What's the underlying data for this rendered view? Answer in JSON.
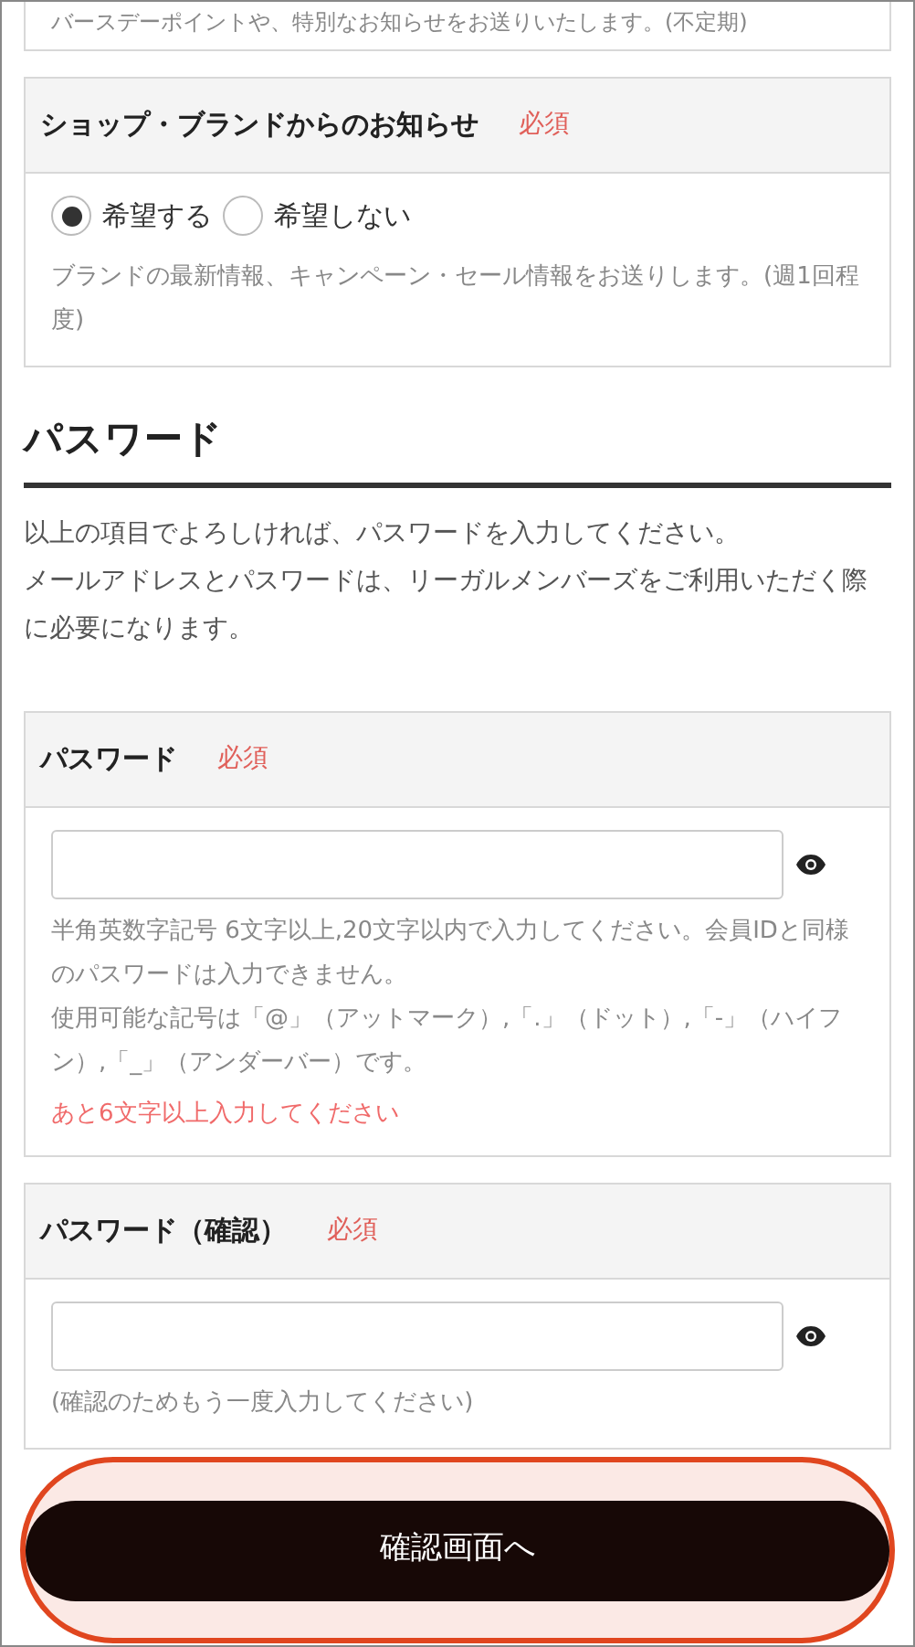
{
  "top_note": "バースデーポイントや、特別なお知らせをお送りいたします。(不定期)",
  "shop_notice": {
    "label": "ショップ・ブランドからのお知らせ",
    "required": "必須",
    "options": [
      {
        "label": "希望する",
        "selected": true
      },
      {
        "label": "希望しない",
        "selected": false
      }
    ],
    "note": "ブランドの最新情報、キャンペーン・セール情報をお送りします。(週1回程度)"
  },
  "password_section": {
    "heading": "パスワード",
    "intro": [
      "以上の項目でよろしければ、パスワードを入力してください。",
      "メールアドレスとパスワードは、リーガルメンバーズをご利用いただく際に必要になります。"
    ]
  },
  "fields": [
    {
      "label": "パスワード",
      "required": "必須",
      "hints": [
        "半角英数字記号 6文字以上,20文字以内で入力してください。会員IDと同様のパスワードは入力できません。",
        "使用可能な記号は「@」（アットマーク）,「.」（ドット）,「-」（ハイフン）,「_」（アンダーバー）です。"
      ],
      "error": "あと6文字以上入力してください"
    },
    {
      "label": "パスワード（確認）",
      "required": "必須",
      "hints": [
        "(確認のためもう一度入力してください)"
      ]
    }
  ],
  "submit": "確認画面へ"
}
